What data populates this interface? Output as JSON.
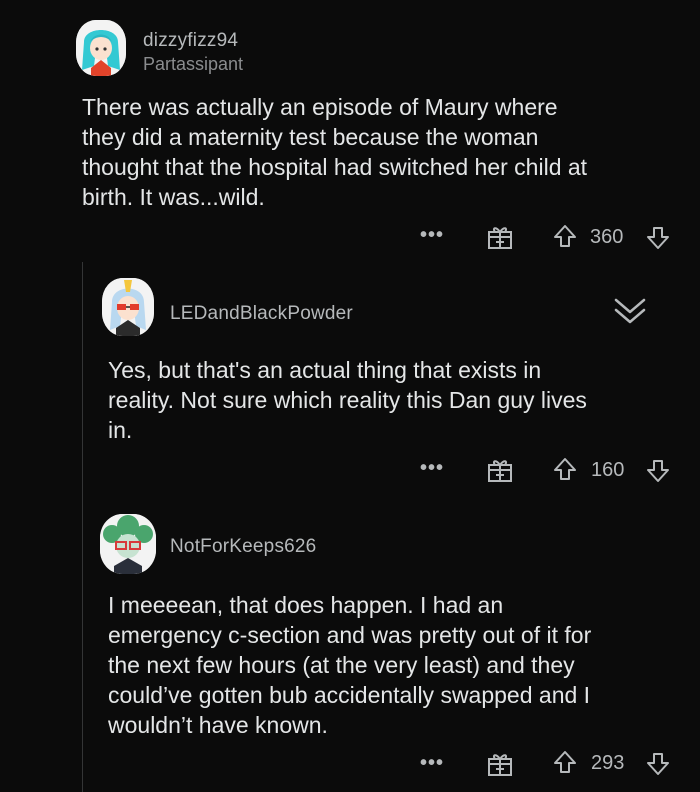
{
  "comments": [
    {
      "username": "dizzyfizz94",
      "flair": "Partassipant",
      "body": [
        "There was actually an episode of Maury where",
        "they did a maternity test because the woman",
        "thought that the hospital had switched her child at",
        "birth. It was...wild."
      ],
      "more": "•••",
      "score": "360"
    },
    {
      "username": "LEDandBlackPowder",
      "body": [
        "Yes, but that's an actual thing that exists in",
        "reality.  Not sure which reality this Dan guy lives",
        "in."
      ],
      "more": "•••",
      "score": "160"
    },
    {
      "username": "NotForKeeps626",
      "body": [
        "I meeeean, that does happen. I had an",
        "emergency c-section and was pretty out of it for",
        "the next few hours (at the very least) and they",
        "could’ve gotten bub accidentally swapped and I",
        "wouldn’t have known."
      ],
      "more": "•••",
      "score": "293"
    }
  ],
  "icons": {
    "gift": "gift-icon",
    "upvote": "upvote-arrow-icon",
    "downvote": "downvote-arrow-icon",
    "collapse": "chevron-double-down-icon"
  },
  "colors": {
    "background": "#0b0b0b",
    "text": "#e4e6e7",
    "meta": "#b6b9bb",
    "thread_line": "#343536"
  }
}
